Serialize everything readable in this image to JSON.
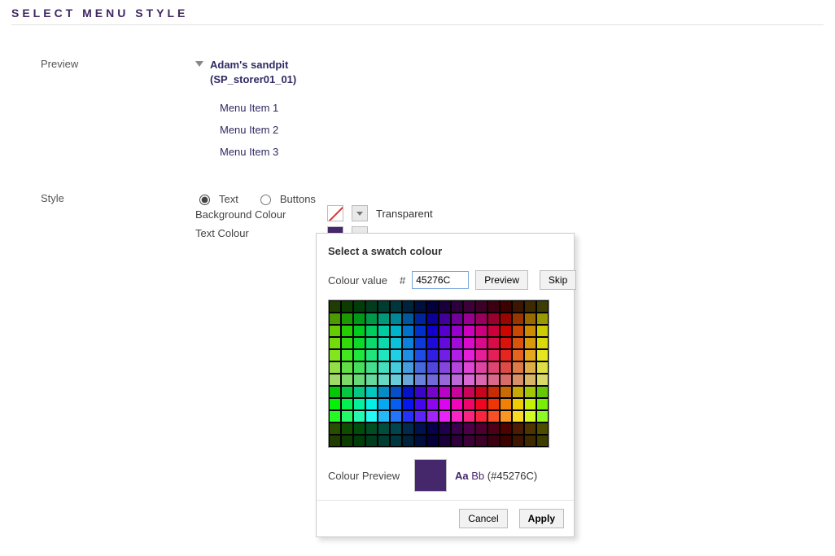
{
  "section_title": "SELECT MENU STYLE",
  "preview": {
    "label": "Preview",
    "root_line1": "Adam's sandpit",
    "root_line2": "(SP_storer01_01)",
    "items": [
      "Menu Item 1",
      "Menu Item 2",
      "Menu Item 3"
    ]
  },
  "style": {
    "label": "Style",
    "radio_text": "Text",
    "radio_buttons": "Buttons",
    "bg_label": "Background Colour",
    "bg_value_label": "Transparent",
    "text_label": "Text Colour",
    "text_swatch_color": "#45276C"
  },
  "modal": {
    "title": "Select a swatch colour",
    "colour_value_label": "Colour value",
    "hash": "#",
    "hex": "45276C",
    "preview_btn": "Preview",
    "skip_btn": "Skip",
    "preview_label": "Colour Preview",
    "sample_aa": "Aa",
    "sample_bb": "Bb",
    "sample_hex_display": "(#45276C)",
    "cancel": "Cancel",
    "apply": "Apply",
    "selected_color": "#45276C"
  }
}
